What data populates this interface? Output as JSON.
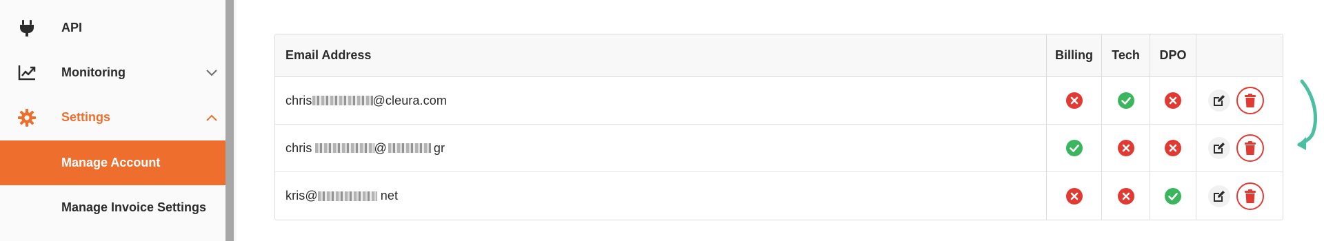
{
  "sidebar": {
    "items": [
      {
        "label": "API",
        "icon": "plug-icon"
      },
      {
        "label": "Monitoring",
        "icon": "chart-line-icon"
      },
      {
        "label": "Settings",
        "icon": "gear-icon"
      },
      {
        "label": "Manage Account"
      },
      {
        "label": "Manage Invoice Settings"
      }
    ]
  },
  "colors": {
    "accent": "#ee6f2d",
    "success": "#3cb65e",
    "danger": "#e03a32",
    "arrow": "#4bbfa1"
  },
  "table": {
    "headers": {
      "email": "Email Address",
      "billing": "Billing",
      "tech": "Tech",
      "dpo": "DPO"
    },
    "rows": [
      {
        "email_prefix": "chris",
        "email_suffix": "@cleura.com",
        "billing": false,
        "tech": true,
        "dpo": false
      },
      {
        "email_prefix": "chris",
        "email_mid": "@",
        "email_suffix": "gr",
        "billing": true,
        "tech": false,
        "dpo": false
      },
      {
        "email_prefix": "kris@",
        "email_suffix": "net",
        "billing": false,
        "tech": false,
        "dpo": true
      }
    ]
  }
}
